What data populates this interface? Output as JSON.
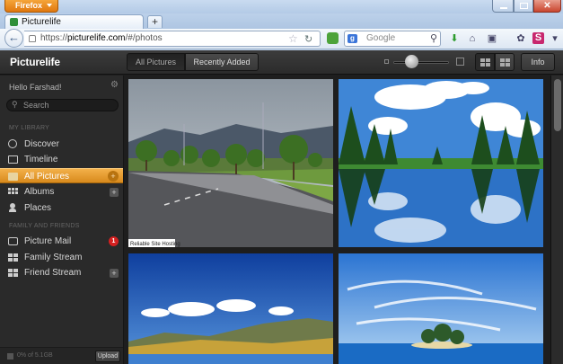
{
  "browser": {
    "menu_button": "Firefox",
    "tab_title": "Picturelife",
    "new_tab": "+",
    "url_prefix": "https://",
    "url_domain": "picturelife.com",
    "url_path": "/#/photos",
    "search_placeholder": "Google",
    "search_engine_letter": "g",
    "close_glyph": "✕"
  },
  "app": {
    "logo": "Picturelife",
    "filter_all": "All Pictures",
    "filter_recent": "Recently Added",
    "info_button": "Info"
  },
  "sidebar": {
    "greeting": "Hello Farshad!",
    "search_placeholder": "Search",
    "section_library": "MY LIBRARY",
    "section_family": "FAMILY AND FRIENDS",
    "items": [
      {
        "label": "Discover"
      },
      {
        "label": "Timeline"
      },
      {
        "label": "All Pictures"
      },
      {
        "label": "Albums"
      },
      {
        "label": "Places"
      },
      {
        "label": "Picture Mail",
        "badge": "1"
      },
      {
        "label": "Family Stream"
      },
      {
        "label": "Friend Stream"
      }
    ],
    "plus": "+",
    "storage_text": "0% of 5.1GB",
    "upload_button": "Upload"
  },
  "photos": [
    {
      "caption": "road-trees-mountains"
    },
    {
      "caption": "lake-reflection-pines"
    },
    {
      "caption": "blue-sky-lake-hills"
    },
    {
      "caption": "tropical-island-sea"
    }
  ],
  "watermark": "Reliable Site Hosting"
}
